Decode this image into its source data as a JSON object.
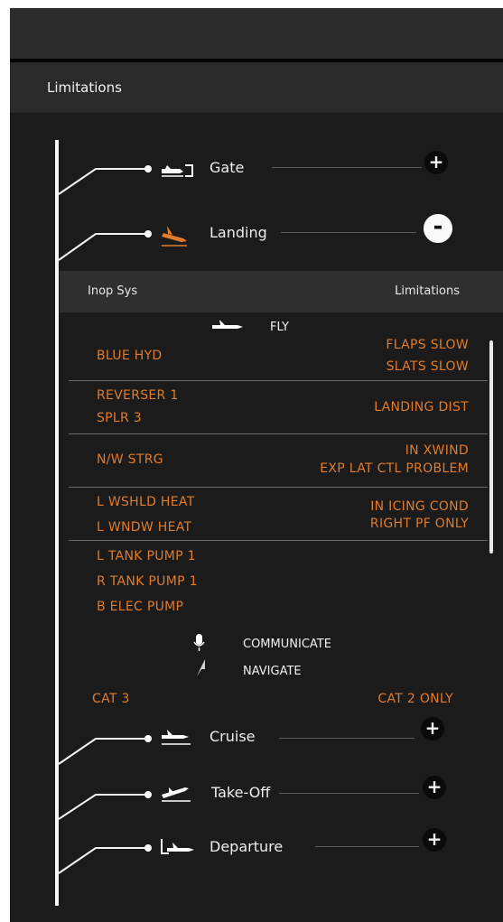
{
  "header": {
    "title": "Limitations"
  },
  "nodes": {
    "gate": {
      "label": "Gate",
      "button": "+"
    },
    "landing": {
      "label": "Landing",
      "button": "-"
    },
    "cruise": {
      "label": "Cruise",
      "button": "+"
    },
    "takeoff": {
      "label": "Take-Off",
      "button": "+"
    },
    "departure": {
      "label": "Departure",
      "button": "+"
    }
  },
  "table": {
    "col_inop": "Inop Sys",
    "col_limitations": "Limitations",
    "fly_label": "FLY",
    "rows": [
      {
        "inop": [
          "BLUE HYD"
        ],
        "limits": [
          "FLAPS SLOW",
          "SLATS SLOW"
        ]
      },
      {
        "inop": [
          "REVERSER 1",
          "SPLR 3"
        ],
        "limits": [
          "LANDING DIST"
        ]
      },
      {
        "inop": [
          "N/W STRG"
        ],
        "limits": [
          "IN XWIND",
          "EXP LAT CTL PROBLEM"
        ]
      },
      {
        "inop": [
          "L WSHLD HEAT",
          "L WNDW HEAT"
        ],
        "limits": [
          "IN ICING COND",
          "RIGHT PF ONLY"
        ]
      },
      {
        "inop": [
          "L TANK PUMP 1",
          "R TANK PUMP 1",
          "B ELEC PUMP"
        ],
        "limits": []
      }
    ],
    "communicate_label": "COMMUNICATE",
    "navigate_label": "NAVIGATE",
    "cat_inop": "CAT 3",
    "cat_limit": "CAT 2 ONLY"
  },
  "colors": {
    "accent": "#e07c2a",
    "background": "#1b1b1b",
    "text": "#eeeeee"
  },
  "icons": [
    "gate-icon",
    "landing-icon",
    "fly-icon",
    "communicate-icon",
    "navigate-icon",
    "cruise-icon",
    "takeoff-icon",
    "departure-icon",
    "plus-icon",
    "minus-icon"
  ]
}
